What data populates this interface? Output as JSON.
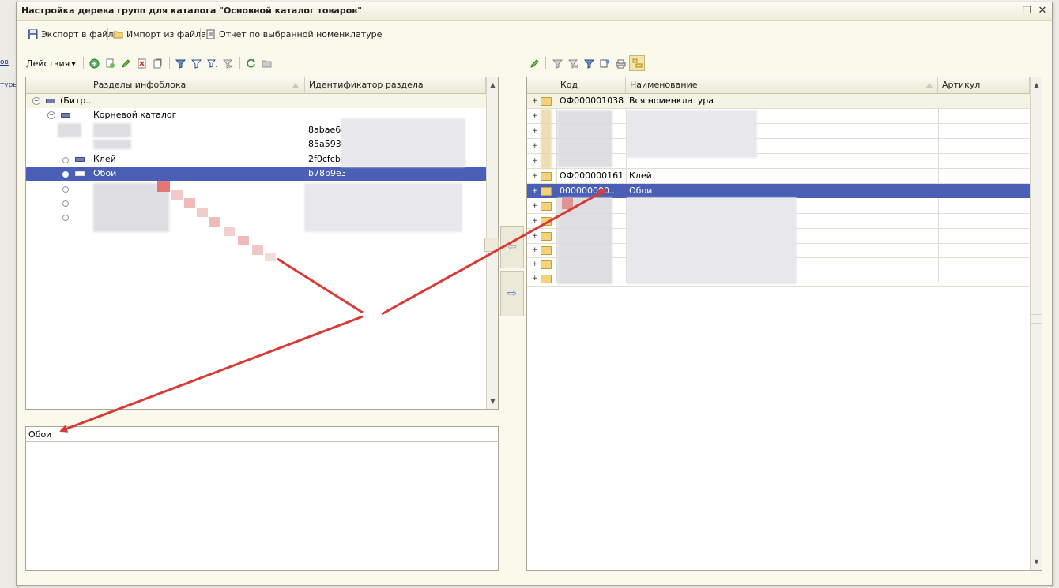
{
  "background_app": {
    "links": [
      "ов",
      "туры"
    ]
  },
  "window": {
    "title": "Настройка дерева групп для каталога \"Основной каталог товаров\"",
    "maximize_glyph": "☐",
    "close_glyph": "✕"
  },
  "command_bar": {
    "export_label": "Экспорт в файл",
    "import_label": "Импорт из файла",
    "report_label": "Отчет по выбранной номенклатуре"
  },
  "left_toolbar": {
    "actions_label": "Действия",
    "actions_arrow": "▾"
  },
  "left_grid": {
    "columns": [
      "Разделы инфоблока",
      "Идентификатор раздела"
    ],
    "rows": [
      {
        "name": "(Битр...",
        "id": ""
      },
      {
        "name": "Корневой каталог",
        "id": ""
      },
      {
        "name": "",
        "id": "8abae6a3"
      },
      {
        "name": "",
        "id": "85a593d9"
      },
      {
        "name": "Клей",
        "id": "2f0cfcba-"
      },
      {
        "name": "Обои",
        "id": "b78b9e34"
      }
    ],
    "selected_row": "Обои"
  },
  "bottom_field": {
    "value": "Обои"
  },
  "transfer_buttons": {
    "left_arrow": "⇦",
    "right_arrow": "⇨"
  },
  "right_grid": {
    "columns": [
      "Код",
      "Наименование",
      "Артикул"
    ],
    "rows": [
      {
        "code": "ОФ000001038",
        "name": "Вся номенклатура",
        "article": ""
      },
      {
        "code": "ОФ000000161",
        "name": "Клей",
        "article": ""
      },
      {
        "code": "000000000...",
        "name": "Обои",
        "article": ""
      }
    ],
    "selected_row": "Обои"
  },
  "colors": {
    "selection": "#4a5fb5",
    "annotation_arrow": "#d93a36",
    "window_bg": "#fbf9ec"
  }
}
